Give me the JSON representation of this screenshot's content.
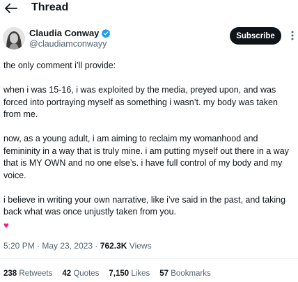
{
  "header": {
    "title": "Thread"
  },
  "author": {
    "name": "Claudia Conway",
    "handle": "@claudiamconwayy",
    "subscribe_label": "Subscribe",
    "verified_color": "#1d9bf0"
  },
  "tweet": {
    "paragraphs": [
      "the only comment i’ll provide:",
      "when i was 15-16, i was exploited by the media, preyed upon, and was forced into portraying myself as something i wasn’t. my body was taken from me.",
      "now, as a young adult, i am aiming to reclaim my womanhood and femininity in a way that is truly mine. i am putting myself out there in a way that is MY OWN and no one else’s. i have full control of my body and my voice.",
      "i believe in writing your own narrative, like i’ve said in the past, and taking back what was once unjustly taken from you."
    ],
    "emoji": "♥"
  },
  "meta": {
    "time": "5:20 PM",
    "separator": " · ",
    "date": "May 23, 2023",
    "views_count": "762.3K",
    "views_label": " Views"
  },
  "stats": [
    {
      "count": "238",
      "label": "Retweets"
    },
    {
      "count": "42",
      "label": "Quotes"
    },
    {
      "count": "7,150",
      "label": "Likes"
    },
    {
      "count": "57",
      "label": "Bookmarks"
    }
  ]
}
